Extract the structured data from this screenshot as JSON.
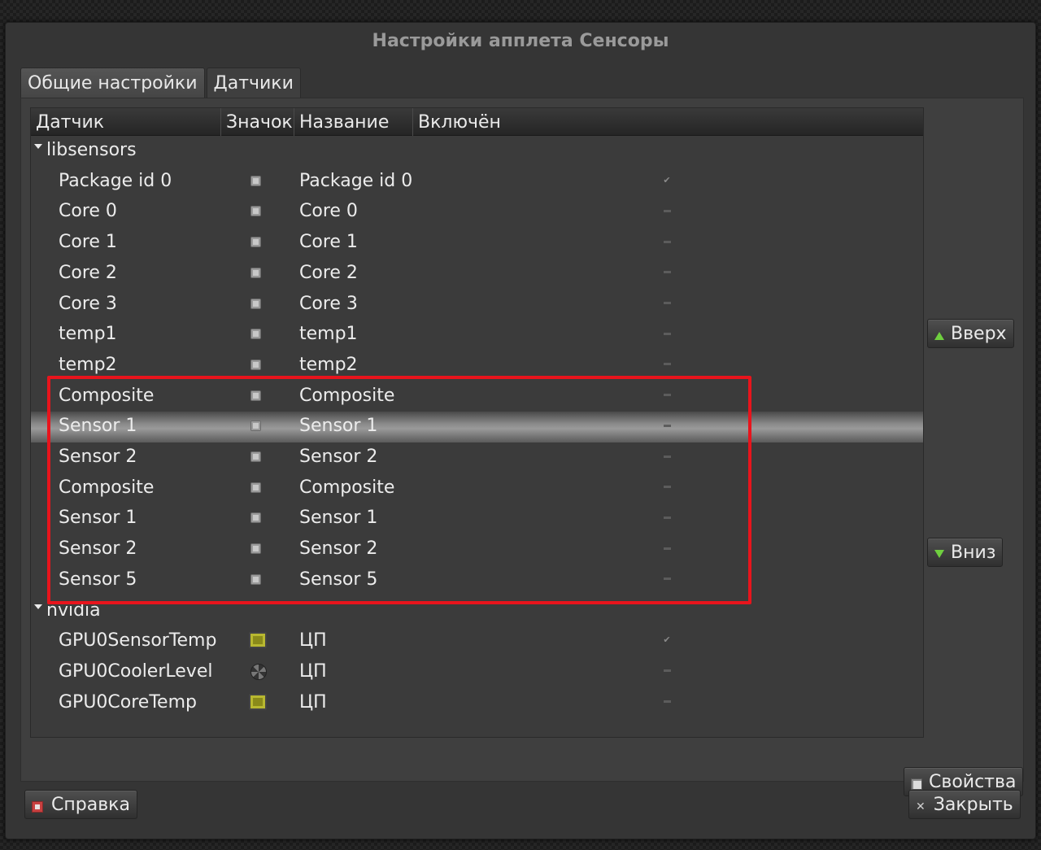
{
  "window": {
    "title": "Настройки апплета Сенсоры"
  },
  "tabs": [
    {
      "label": "Общие настройки"
    },
    {
      "label": "Датчики",
      "active": true
    }
  ],
  "columns": {
    "sensor": "Датчик",
    "icon": "Значок",
    "name": "Название",
    "enabled": "Включён"
  },
  "groups": [
    {
      "label": "libsensors",
      "expanded": true,
      "rows": [
        {
          "sensor": "Package id 0",
          "icon": "chip-icon",
          "name": "Package id 0",
          "enabled": true
        },
        {
          "sensor": "Core 0",
          "icon": "chip-icon",
          "name": "Core 0",
          "enabled": false
        },
        {
          "sensor": "Core 1",
          "icon": "chip-icon",
          "name": "Core 1",
          "enabled": false
        },
        {
          "sensor": "Core 2",
          "icon": "chip-icon",
          "name": "Core 2",
          "enabled": false
        },
        {
          "sensor": "Core 3",
          "icon": "chip-icon",
          "name": "Core 3",
          "enabled": false
        },
        {
          "sensor": "temp1",
          "icon": "chip-icon",
          "name": "temp1",
          "enabled": false
        },
        {
          "sensor": "temp2",
          "icon": "chip-icon",
          "name": "temp2",
          "enabled": false
        },
        {
          "sensor": "Composite",
          "icon": "chip-icon",
          "name": "Composite",
          "enabled": false
        },
        {
          "sensor": "Sensor 1",
          "icon": "chip-icon",
          "name": "Sensor 1",
          "enabled": false,
          "selected": true
        },
        {
          "sensor": "Sensor 2",
          "icon": "chip-icon",
          "name": "Sensor 2",
          "enabled": false
        },
        {
          "sensor": "Composite",
          "icon": "chip-icon",
          "name": "Composite",
          "enabled": false
        },
        {
          "sensor": "Sensor 1",
          "icon": "chip-icon",
          "name": "Sensor 1",
          "enabled": false
        },
        {
          "sensor": "Sensor 2",
          "icon": "chip-icon",
          "name": "Sensor 2",
          "enabled": false
        },
        {
          "sensor": "Sensor 5",
          "icon": "chip-icon",
          "name": "Sensor 5",
          "enabled": false
        }
      ]
    },
    {
      "label": "nvidia",
      "expanded": true,
      "rows": [
        {
          "sensor": "GPU0SensorTemp",
          "icon": "gpu-chip-icon",
          "name": "ЦП",
          "enabled": true
        },
        {
          "sensor": "GPU0CoolerLevel",
          "icon": "fan-icon",
          "name": "ЦП",
          "enabled": false
        },
        {
          "sensor": "GPU0CoreTemp",
          "icon": "gpu-chip-icon",
          "name": "ЦП",
          "enabled": false
        }
      ]
    }
  ],
  "buttons": {
    "up": "Вверх",
    "down": "Вниз",
    "properties": "Свойства",
    "help": "Справка",
    "close": "Закрыть"
  },
  "colors": {
    "highlight": "#e8141c",
    "arrow": "#6fcf3f"
  }
}
